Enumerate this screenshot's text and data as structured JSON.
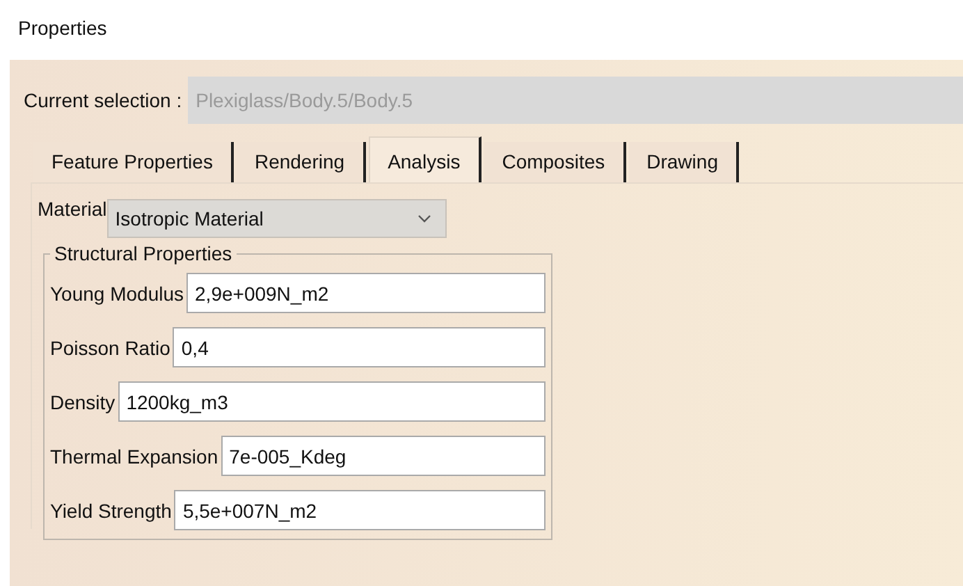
{
  "window": {
    "title": "Properties"
  },
  "current_selection": {
    "label": "Current selection :",
    "value": "Plexiglass/Body.5/Body.5",
    "disabled": true
  },
  "tabs": [
    {
      "label": "Feature Properties",
      "selected": false
    },
    {
      "label": "Rendering",
      "selected": false
    },
    {
      "label": "Analysis",
      "selected": true
    },
    {
      "label": "Composites",
      "selected": false
    },
    {
      "label": "Drawing",
      "selected": false
    }
  ],
  "material": {
    "label": "Material",
    "value": "Isotropic Material"
  },
  "group": {
    "title": "Structural Properties",
    "fields": [
      {
        "label": "Young Modulus",
        "value": "2,9e+009N_m2"
      },
      {
        "label": "Poisson Ratio",
        "value": "0,4"
      },
      {
        "label": "Density",
        "value": "1200kg_m3"
      },
      {
        "label": "Thermal Expansion",
        "value": "7e-005_Kdeg"
      },
      {
        "label": "Yield Strength",
        "value": "5,5e+007N_m2"
      }
    ]
  }
}
